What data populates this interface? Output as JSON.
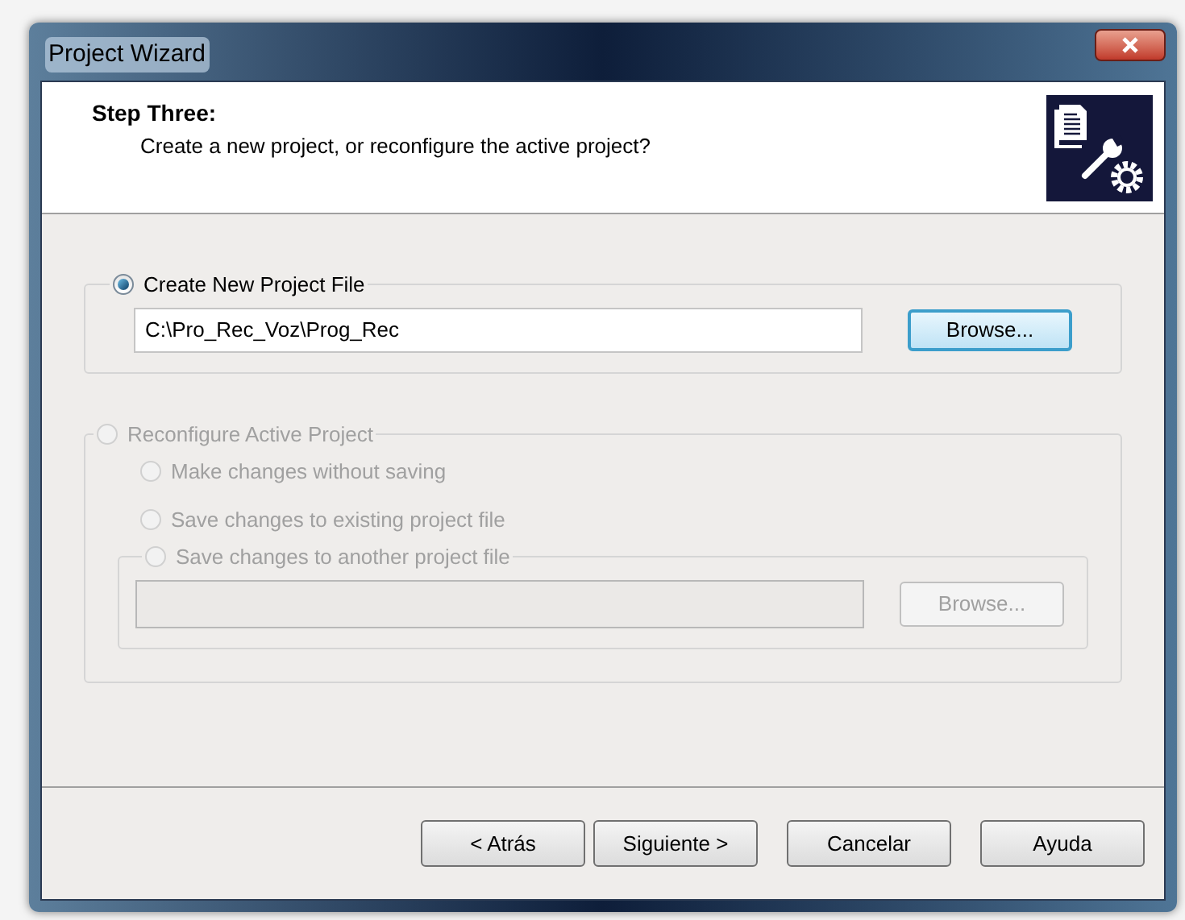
{
  "window": {
    "title": "Project Wizard"
  },
  "header": {
    "title": "Step Three:",
    "subtitle": "Create a new project, or reconfigure the active project?"
  },
  "create_group": {
    "label": "Create New Project File",
    "selected": true,
    "disabled": false,
    "path": "C:\\Pro_Rec_Voz\\Prog_Rec",
    "browse": {
      "label": "Browse...",
      "disabled": false,
      "focused": true
    }
  },
  "reconfigure_group": {
    "label": "Reconfigure Active Project",
    "selected": false,
    "disabled": true,
    "options": [
      {
        "label": "Make changes without saving",
        "selected": false,
        "disabled": true
      },
      {
        "label": "Save changes to existing project file",
        "selected": false,
        "disabled": true
      }
    ],
    "another_file": {
      "label": "Save changes to another project file",
      "selected": false,
      "disabled": true,
      "browse": {
        "label": "Browse...",
        "disabled": true,
        "focused": false
      }
    }
  },
  "buttons": [
    {
      "label": "< Atrás"
    },
    {
      "label": "Siguiente >"
    },
    {
      "label": "Cancelar"
    },
    {
      "label": "Ayuda"
    }
  ]
}
